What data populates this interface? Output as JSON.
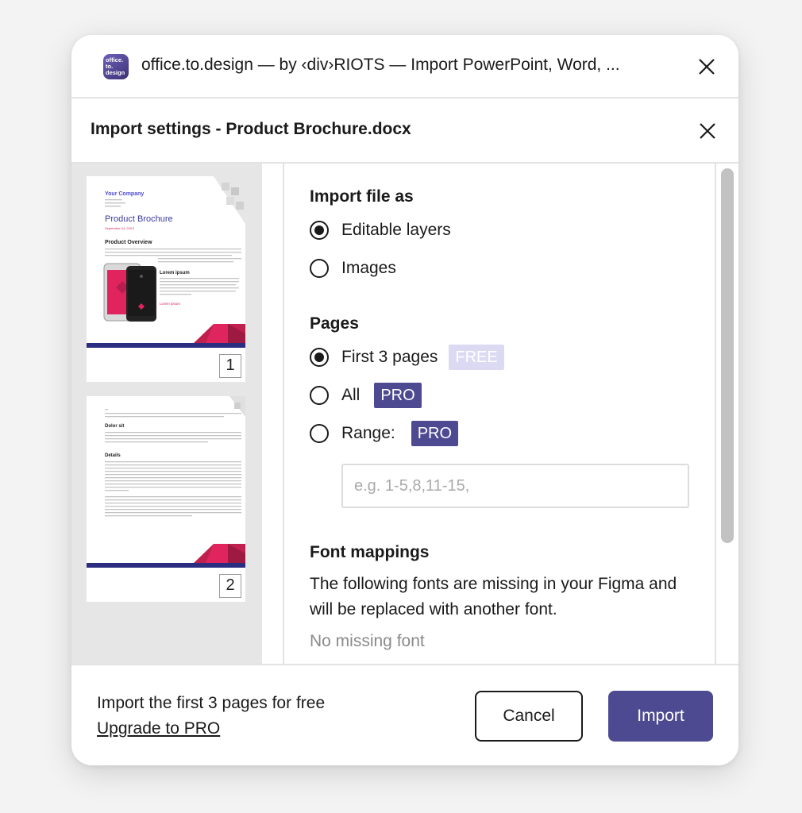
{
  "plugin": {
    "icon_text": "office.\nto.\ndesign",
    "title": "office.to.design — by ‹div›RIOTS — Import PowerPoint, Word, ..."
  },
  "dialog": {
    "title": "Import settings - Product Brochure.docx"
  },
  "thumbnails": [
    {
      "page_number": "1",
      "company": "Your Company",
      "address": "123 Your Street\nYour City, ST 12345\n(123) 456 - 7890",
      "heading": "Product Brochure",
      "date": "September 04, 20XX",
      "section": "Product Overview",
      "subheading": "Lorem ipsum",
      "link": "Lorem ipsum"
    },
    {
      "page_number": "2",
      "heading1": "Dolor sit",
      "heading2": "Details"
    }
  ],
  "import_as": {
    "title": "Import file as",
    "options": [
      {
        "label": "Editable layers",
        "checked": true
      },
      {
        "label": "Images",
        "checked": false
      }
    ]
  },
  "pages": {
    "title": "Pages",
    "options": [
      {
        "label": "First 3 pages",
        "badge": "FREE",
        "checked": true
      },
      {
        "label": "All",
        "badge": "PRO",
        "checked": false
      },
      {
        "label": "Range:",
        "badge": "PRO",
        "checked": false
      }
    ],
    "range_placeholder": "e.g. 1-5,8,11-15,",
    "range_value": ""
  },
  "fonts": {
    "title": "Font mappings",
    "description": "The following fonts are missing in your Figma and will be replaced with another font.",
    "status": "No missing font"
  },
  "footer": {
    "message": "Import the first 3 pages for free",
    "upgrade_link": "Upgrade to PRO",
    "cancel_label": "Cancel",
    "import_label": "Import"
  },
  "colors": {
    "accent": "#4e4a92",
    "badge_free": "#dcdaf3",
    "brochure_pink": "#e0245e",
    "brochure_navy": "#2b2d80"
  }
}
